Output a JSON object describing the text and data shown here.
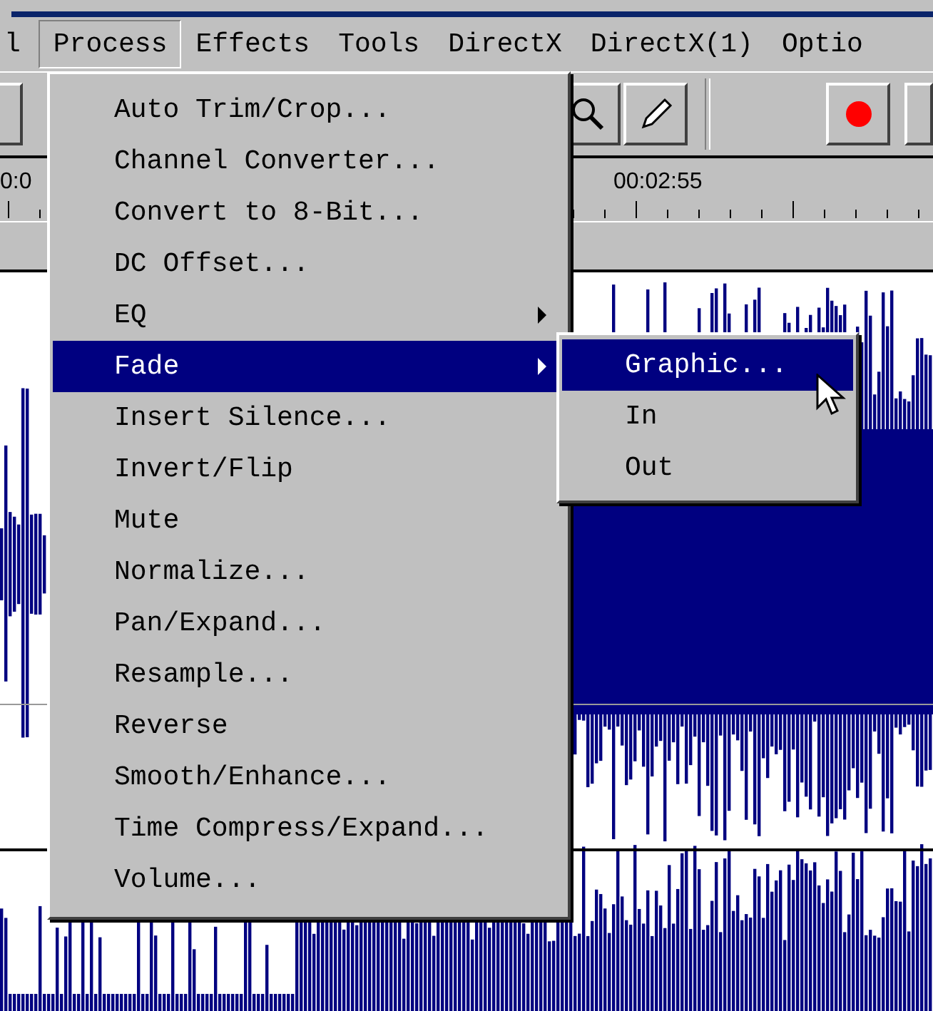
{
  "menu_bar": [
    {
      "label": "l",
      "selected": false
    },
    {
      "label": "Process",
      "selected": true
    },
    {
      "label": "Effects",
      "selected": false
    },
    {
      "label": "Tools",
      "selected": false
    },
    {
      "label": "DirectX",
      "selected": false
    },
    {
      "label": "DirectX(1)",
      "selected": false
    },
    {
      "label": "Optio",
      "selected": false
    }
  ],
  "ruler": {
    "labels": [
      "0:0",
      "00:02:55"
    ]
  },
  "process_menu": {
    "items": [
      {
        "label": "Auto Trim/Crop...",
        "submenu": false,
        "selected": false
      },
      {
        "label": "Channel Converter...",
        "submenu": false,
        "selected": false
      },
      {
        "label": "Convert to 8-Bit...",
        "submenu": false,
        "selected": false
      },
      {
        "label": "DC Offset...",
        "submenu": false,
        "selected": false
      },
      {
        "label": "EQ",
        "submenu": true,
        "selected": false
      },
      {
        "label": "Fade",
        "submenu": true,
        "selected": true
      },
      {
        "label": "Insert Silence...",
        "submenu": false,
        "selected": false
      },
      {
        "label": "Invert/Flip",
        "submenu": false,
        "selected": false
      },
      {
        "label": "Mute",
        "submenu": false,
        "selected": false
      },
      {
        "label": "Normalize...",
        "submenu": false,
        "selected": false
      },
      {
        "label": "Pan/Expand...",
        "submenu": false,
        "selected": false
      },
      {
        "label": "Resample...",
        "submenu": false,
        "selected": false
      },
      {
        "label": "Reverse",
        "submenu": false,
        "selected": false
      },
      {
        "label": "Smooth/Enhance...",
        "submenu": false,
        "selected": false
      },
      {
        "label": "Time Compress/Expand...",
        "submenu": false,
        "selected": false
      },
      {
        "label": "Volume...",
        "submenu": false,
        "selected": false
      }
    ]
  },
  "fade_submenu": {
    "items": [
      {
        "label": "Graphic...",
        "selected": true
      },
      {
        "label": "In",
        "selected": false
      },
      {
        "label": "Out",
        "selected": false
      }
    ]
  }
}
